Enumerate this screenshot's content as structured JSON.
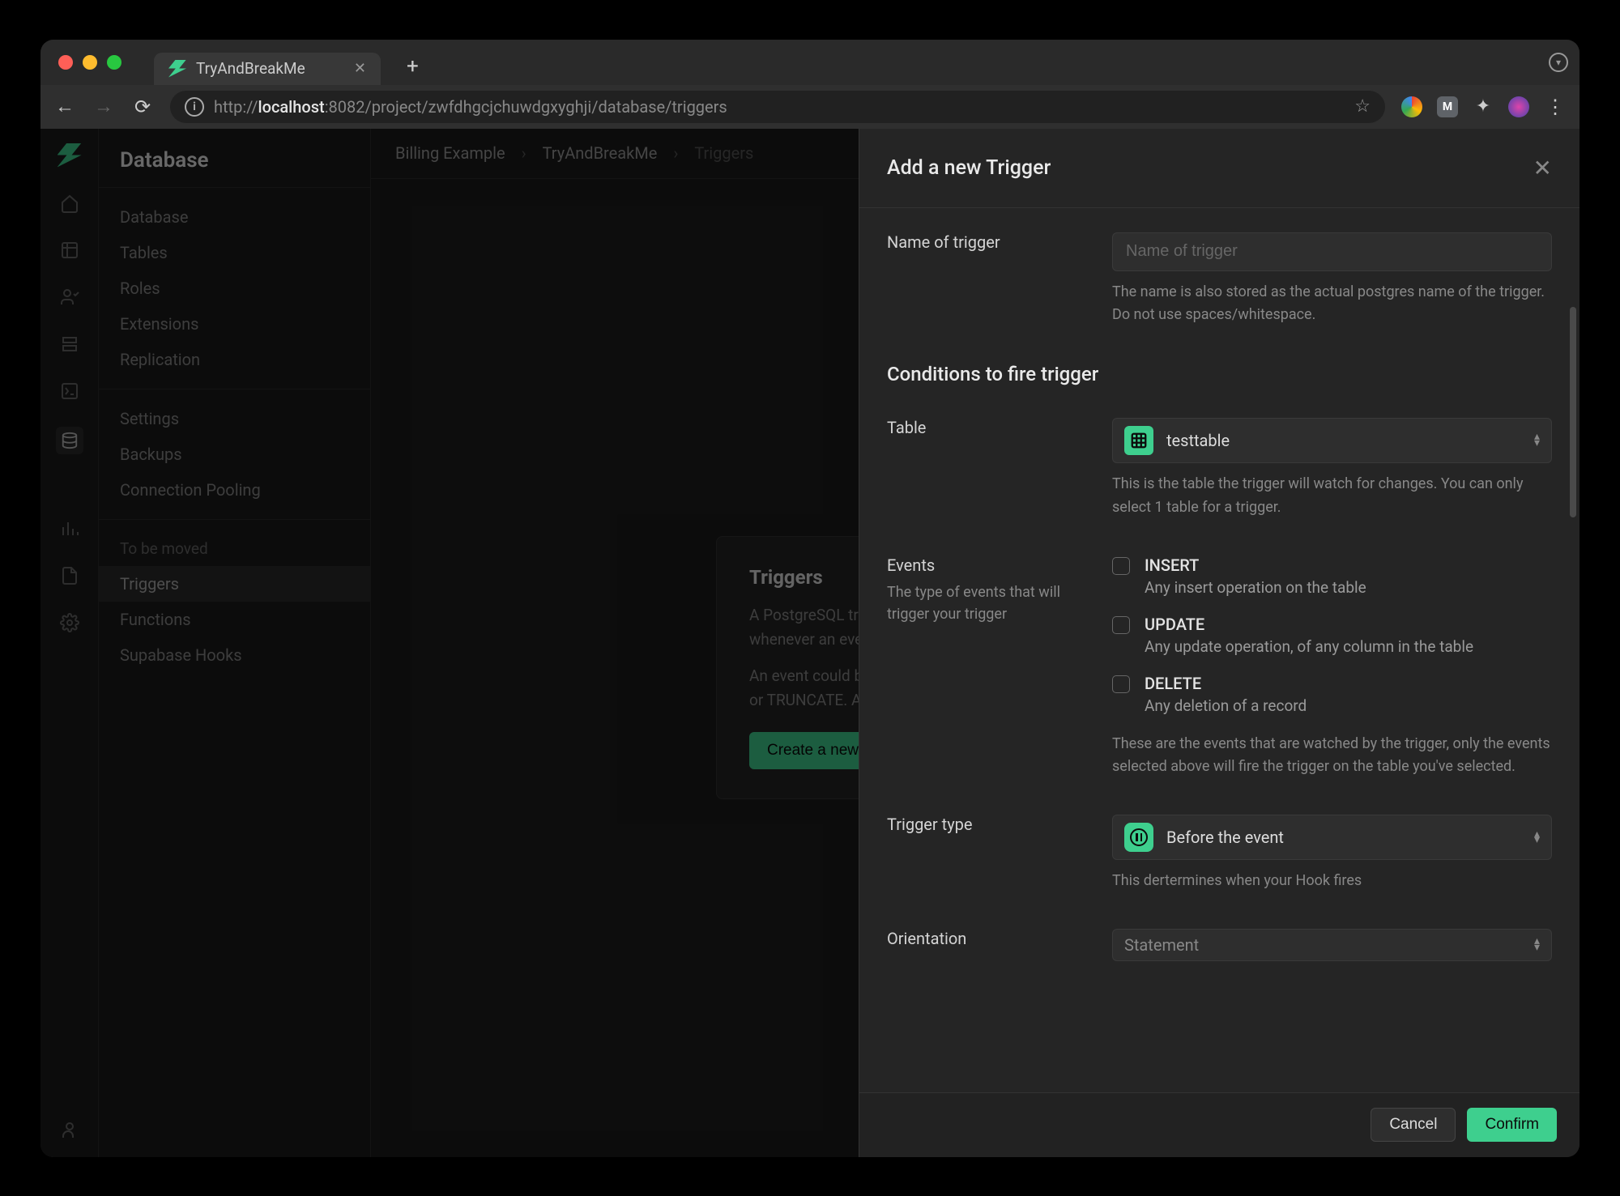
{
  "browser": {
    "tab_title": "TryAndBreakMe",
    "url_prefix": "http://",
    "url_host": "localhost",
    "url_rest": ":8082/project/zwfdhgcjchuwdgxyghji/database/triggers"
  },
  "page_title": "Database",
  "sidenav": {
    "group1": [
      "Database",
      "Tables",
      "Roles",
      "Extensions",
      "Replication"
    ],
    "group2": [
      "Settings",
      "Backups",
      "Connection Pooling"
    ],
    "group3_label": "To be moved",
    "group3": [
      "Triggers",
      "Functions",
      "Supabase Hooks"
    ]
  },
  "breadcrumb": [
    "Billing Example",
    "TryAndBreakMe",
    "Triggers"
  ],
  "empty": {
    "title": "Triggers",
    "p1": "A PostgreSQL trigger is a function invoked automatically whenever an event associated with a table occurs.",
    "p2": "An event could be any of the following: INSERT, UPDATE, DELETE or TRUNCATE. A trigger is defined for one table.",
    "button": "Create a new trigger"
  },
  "panel": {
    "title": "Add a new Trigger",
    "name": {
      "label": "Name of trigger",
      "placeholder": "Name of trigger",
      "helper": "The name is also stored as the actual postgres name of the trigger. Do not use spaces/whitespace."
    },
    "section": "Conditions to fire trigger",
    "table": {
      "label": "Table",
      "value": "testtable",
      "helper": "This is the table the trigger will watch for changes. You can only select 1 table for a trigger."
    },
    "events": {
      "label": "Events",
      "sublabel": "The type of events that will trigger your trigger",
      "items": [
        {
          "name": "INSERT",
          "desc": "Any insert operation on the table"
        },
        {
          "name": "UPDATE",
          "desc": "Any update operation, of any column in the table"
        },
        {
          "name": "DELETE",
          "desc": "Any deletion of a record"
        }
      ],
      "helper": "These are the events that are watched by the trigger, only the events selected above will fire the trigger on the table you've selected."
    },
    "trigger_type": {
      "label": "Trigger type",
      "value": "Before the event",
      "helper": "This dertermines when your Hook fires"
    },
    "orientation": {
      "label": "Orientation",
      "value": "Statement"
    },
    "footer": {
      "cancel": "Cancel",
      "confirm": "Confirm"
    }
  }
}
